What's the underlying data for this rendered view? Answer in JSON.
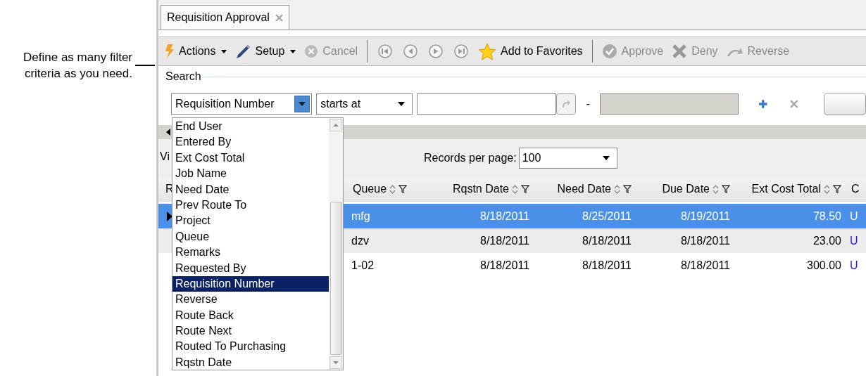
{
  "callout": {
    "text": "Define as many filter criteria as you need."
  },
  "tabs": [
    {
      "label": "Requisition Approval",
      "selected": true
    }
  ],
  "toolbar": [
    {
      "kind": "menu",
      "label": "Actions",
      "disabled": false
    },
    {
      "kind": "menu",
      "label": "Setup",
      "disabled": false
    },
    {
      "kind": "button",
      "label": "Cancel",
      "disabled": true
    },
    {
      "kind": "separator"
    },
    {
      "kind": "nav",
      "disabled": true
    },
    {
      "kind": "nav",
      "disabled": true
    },
    {
      "kind": "nav",
      "disabled": true
    },
    {
      "kind": "nav",
      "disabled": true
    },
    {
      "kind": "button",
      "label": "Add to Favorites",
      "disabled": false
    },
    {
      "kind": "separator"
    },
    {
      "kind": "button",
      "label": "Approve",
      "disabled": true
    },
    {
      "kind": "button",
      "label": "Deny",
      "disabled": true
    },
    {
      "kind": "button",
      "label": "Reverse",
      "disabled": true
    }
  ],
  "search": {
    "legend": "Search",
    "field": "Requisition Number",
    "operator": "starts at",
    "range_separator": "-",
    "to_disabled": true
  },
  "field_list": {
    "open": true,
    "items": [
      {
        "label": "End User",
        "selected": false
      },
      {
        "label": "Entered By",
        "selected": false
      },
      {
        "label": "Ext Cost Total",
        "selected": false
      },
      {
        "label": "Job Name",
        "selected": false
      },
      {
        "label": "Need Date",
        "selected": false
      },
      {
        "label": "Prev Route To",
        "selected": false
      },
      {
        "label": "Project",
        "selected": false
      },
      {
        "label": "Queue",
        "selected": false
      },
      {
        "label": "Remarks",
        "selected": false
      },
      {
        "label": "Requested By",
        "selected": false
      },
      {
        "label": "Requisition Number",
        "selected": true
      },
      {
        "label": "Reverse",
        "selected": false
      },
      {
        "label": "Route Back",
        "selected": false
      },
      {
        "label": "Route Next",
        "selected": false
      },
      {
        "label": "Routed To Purchasing",
        "selected": false
      },
      {
        "label": "Rqstn Date",
        "selected": false
      }
    ]
  },
  "view_label": "Vi",
  "records_per_page": {
    "label": "Records per page:",
    "value": "100"
  },
  "table": {
    "columns": [
      {
        "label": "R"
      },
      {
        "label": "Queue"
      },
      {
        "label": "Rqstn Date"
      },
      {
        "label": "Need Date"
      },
      {
        "label": "Due Date"
      },
      {
        "label": "Ext Cost Total"
      },
      {
        "label": "C"
      }
    ],
    "rows": [
      {
        "selected": true,
        "current": true,
        "cells": [
          "",
          "mfg",
          "8/18/2011",
          "8/25/2011",
          "8/19/2011",
          "78.50",
          "U"
        ]
      },
      {
        "selected": false,
        "current": false,
        "cells": [
          "",
          "dzv",
          "8/18/2011",
          "8/18/2011",
          "8/18/2011",
          "23.00",
          "U"
        ]
      },
      {
        "selected": false,
        "current": false,
        "cells": [
          "",
          "1-02",
          "8/18/2011",
          "8/18/2011",
          "8/18/2011",
          "300.00",
          "U"
        ]
      }
    ]
  }
}
